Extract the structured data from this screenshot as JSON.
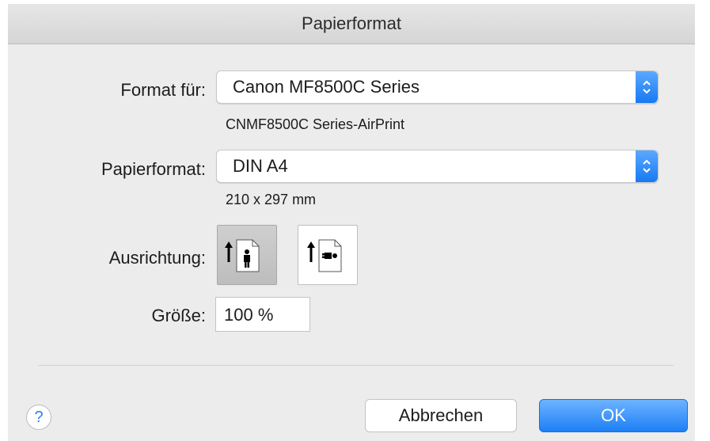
{
  "dialog": {
    "title": "Papierformat",
    "format_for": {
      "label": "Format für:",
      "value": "Canon MF8500C Series",
      "detail": "CNMF8500C Series-AirPrint"
    },
    "paper_size": {
      "label": "Papierformat:",
      "value": "DIN A4",
      "detail": "210 x 297 mm"
    },
    "orientation": {
      "label": "Ausrichtung:",
      "selected": "portrait"
    },
    "scale": {
      "label": "Größe:",
      "value": "100 %"
    },
    "buttons": {
      "help": "?",
      "cancel": "Abbrechen",
      "ok": "OK"
    }
  },
  "colors": {
    "accent": "#1c7ff5",
    "window_bg": "#ececec"
  }
}
